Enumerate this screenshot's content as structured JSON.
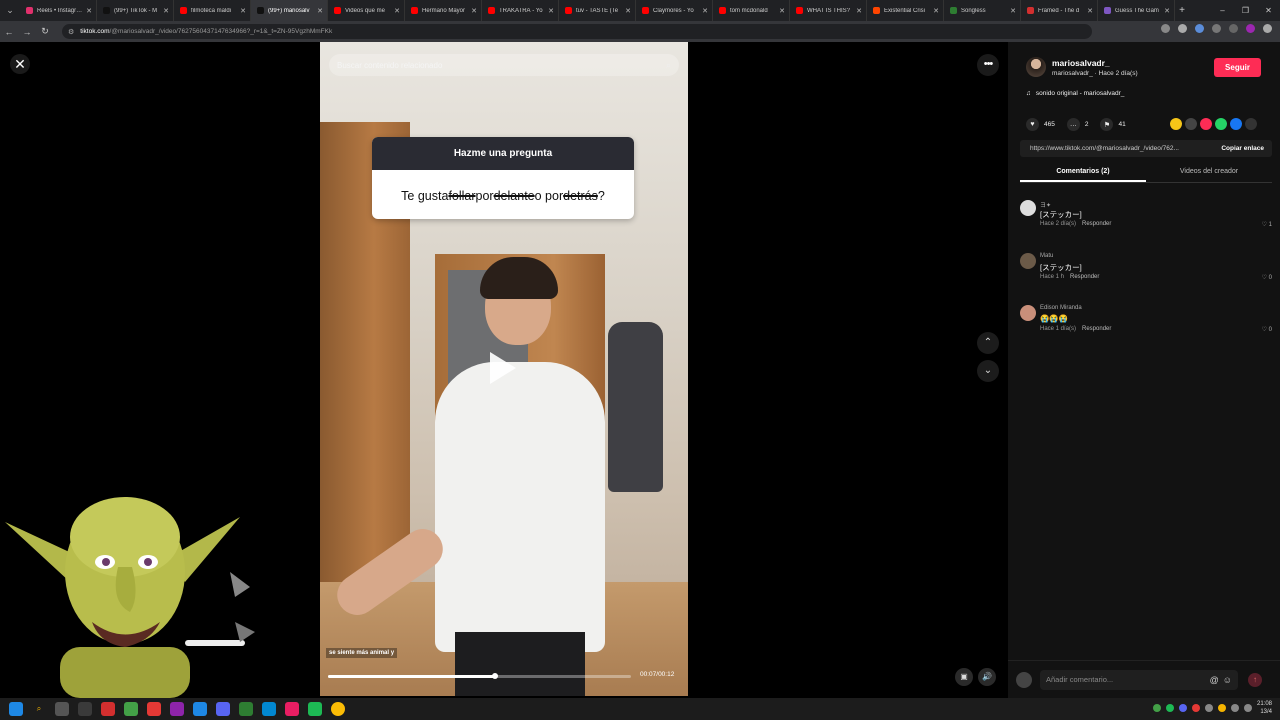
{
  "browser": {
    "tabs": [
      {
        "title": "Reels • Instagram",
        "color": "#e1306c",
        "active": false
      },
      {
        "title": "(99+) TikTok - M",
        "color": "#111111",
        "active": false
      },
      {
        "title": "filmoteca maldi",
        "color": "#ff0000",
        "active": false
      },
      {
        "title": "(99+) mariosalv",
        "color": "#111111",
        "active": true
      },
      {
        "title": "Videos que me",
        "color": "#ff0000",
        "active": false
      },
      {
        "title": "Hermano Mayor",
        "color": "#ff0000",
        "active": false
      },
      {
        "title": "TRAKATRÁ - Yo",
        "color": "#ff0000",
        "active": false
      },
      {
        "title": "tuv - TASTE (Te",
        "color": "#ff0000",
        "active": false
      },
      {
        "title": "Claymores - Yo",
        "color": "#ff0000",
        "active": false
      },
      {
        "title": "tom mcdonald",
        "color": "#ff0000",
        "active": false
      },
      {
        "title": "WHAT IS THIS?",
        "color": "#ff0000",
        "active": false
      },
      {
        "title": "Existential Crisi",
        "color": "#ff4500",
        "active": false
      },
      {
        "title": "Songless",
        "color": "#2e7d32",
        "active": false
      },
      {
        "title": "Framed - The d",
        "color": "#d32f2f",
        "active": false
      },
      {
        "title": "Guess The Gam",
        "color": "#7e57c2",
        "active": false
      }
    ],
    "url_host": "tiktok.com",
    "url_path": "/@mariosalvadr_/video/7627560437147634966?_r=1&_t=ZN-95VgzhMmFKk"
  },
  "search": {
    "placeholder": "Buscar contenido relacionado"
  },
  "video": {
    "question_header": "Hazme una pregunta",
    "question_parts": {
      "p1": "Te gusta ",
      "s1": "follar",
      "p2": " por ",
      "s2": "delante",
      "p3": " o por ",
      "s3": "detrás",
      "p4": "?"
    },
    "caption": "se siente más animal y",
    "time": "00:07/00:12",
    "progress": 0.55
  },
  "author": {
    "username": "mariosalvadr_",
    "subline": "mariosalvadr_ · Hace 2 día(s)",
    "follow_label": "Seguir",
    "sound": "sonido original - mariosalvadr_"
  },
  "stats": {
    "likes": "465",
    "comments": "2",
    "saves": "41"
  },
  "link": {
    "url": "https://www.tiktok.com/@mariosalvadr_/video/762...",
    "copy_label": "Copiar enlace"
  },
  "panel_tabs": {
    "comments": "Comentarios (2)",
    "creator": "Videos del creador"
  },
  "comments": [
    {
      "name": "ヨ✦",
      "text": "[ステッカー]",
      "time": "Hace 2 día(s)",
      "reply": "Responder",
      "likes": "1"
    },
    {
      "name": "Matu",
      "text": "[ステッカー]",
      "time": "Hace 1 h",
      "reply": "Responder",
      "likes": "0"
    },
    {
      "name": "Edison Miranda",
      "text": "😭😭😭",
      "time": "Hace 1 día(s)",
      "reply": "Responder",
      "likes": "0"
    }
  ],
  "add_comment": {
    "placeholder": "Añadir comentario..."
  },
  "taskbar": {
    "time": "21:08",
    "date": "13/4"
  }
}
